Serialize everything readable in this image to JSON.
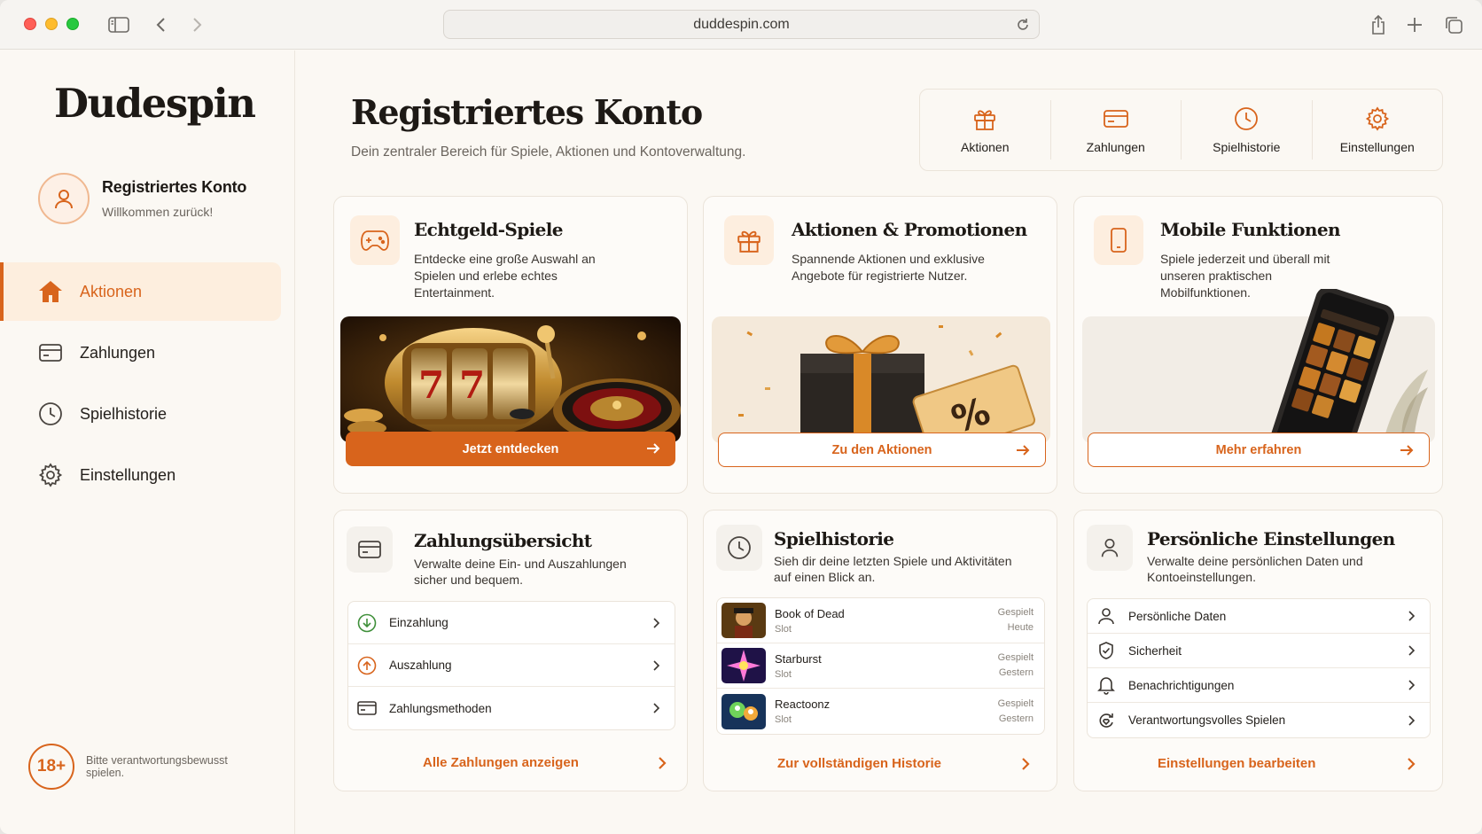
{
  "browser": {
    "url": "duddespin.com"
  },
  "sidebar": {
    "logo": "Dudespin",
    "user": {
      "name": "Registriertes Konto",
      "subtitle": "Willkommen zurück!"
    },
    "nav": [
      {
        "label": "Aktionen",
        "icon": "home-icon",
        "active": true
      },
      {
        "label": "Zahlungen",
        "icon": "credit-card-icon",
        "active": false
      },
      {
        "label": "Spielhistorie",
        "icon": "clock-icon",
        "active": false
      },
      {
        "label": "Einstellungen",
        "icon": "gear-icon",
        "active": false
      }
    ],
    "age": {
      "badge": "18+",
      "text": "Bitte verantwortungsbewusst spielen."
    }
  },
  "header": {
    "title": "Registriertes Konto",
    "subtitle": "Dein zentraler Bereich für Spiele, Aktionen und Kontoverwaltung.",
    "quick_actions": [
      {
        "label": "Aktionen",
        "icon": "gift-icon"
      },
      {
        "label": "Zahlungen",
        "icon": "credit-card-icon"
      },
      {
        "label": "Spielhistorie",
        "icon": "clock-icon"
      },
      {
        "label": "Einstellungen",
        "icon": "gear-icon"
      }
    ]
  },
  "cards": {
    "games": {
      "title": "Echtgeld-Spiele",
      "desc": "Entdecke eine große Auswahl an Spielen und erlebe echtes Entertainment.",
      "button": "Jetzt entdecken"
    },
    "promos": {
      "title": "Aktionen & Promotionen",
      "desc": "Spannende Aktionen und exklusive Angebote für registrierte Nutzer.",
      "button": "Zu den Aktionen",
      "ticket_symbol": "%"
    },
    "mobile": {
      "title": "Mobile Funktionen",
      "desc": "Spiele jederzeit und überall mit unseren praktischen Mobilfunktionen.",
      "button": "Mehr erfahren"
    },
    "payments": {
      "title": "Zahlungsübersicht",
      "desc": "Verwalte deine Ein- und Auszahlungen sicher und bequem.",
      "items": [
        {
          "label": "Einzahlung",
          "icon": "arrow-down-circle-icon"
        },
        {
          "label": "Auszahlung",
          "icon": "arrow-up-circle-icon"
        },
        {
          "label": "Zahlungsmethoden",
          "icon": "credit-card-icon"
        }
      ],
      "link": "Alle Zahlungen anzeigen"
    },
    "history": {
      "title": "Spielhistorie",
      "desc": "Sieh dir deine letzten Spiele und Aktivitäten auf einen Blick an.",
      "items": [
        {
          "name": "Book of Dead",
          "type": "Slot",
          "status": "Gespielt",
          "when": "Heute"
        },
        {
          "name": "Starburst",
          "type": "Slot",
          "status": "Gespielt",
          "when": "Gestern"
        },
        {
          "name": "Reactoonz",
          "type": "Slot",
          "status": "Gespielt",
          "when": "Gestern"
        }
      ],
      "link": "Zur vollständigen Historie"
    },
    "settings": {
      "title": "Persönliche Einstellungen",
      "desc": "Verwalte deine persönlichen Daten und Kontoeinstellungen.",
      "items": [
        {
          "label": "Persönliche Daten",
          "icon": "user-icon"
        },
        {
          "label": "Sicherheit",
          "icon": "shield-check-icon"
        },
        {
          "label": "Benachrichtigungen",
          "icon": "bell-icon"
        },
        {
          "label": "Verantwortungsvolles Spielen",
          "icon": "responsible-gaming-icon"
        }
      ],
      "link": "Einstellungen bearbeiten"
    }
  },
  "colors": {
    "accent": "#d8641c",
    "background": "#fbf8f3",
    "accent_light": "#fdeede"
  }
}
